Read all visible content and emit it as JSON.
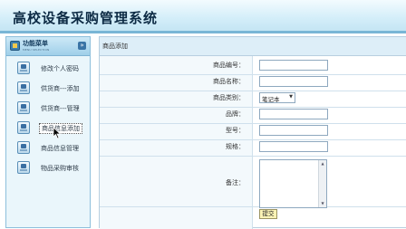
{
  "app": {
    "title": "高校设备采购管理系统"
  },
  "sidebar": {
    "title": "功能菜单",
    "subtitle": "MENU SELECTION",
    "items": [
      {
        "label": "修改个人密码",
        "icon": "user-key-icon"
      },
      {
        "label": "供货商---添加",
        "icon": "supplier-add-icon"
      },
      {
        "label": "供货商---管理",
        "icon": "supplier-manage-icon"
      },
      {
        "label": "商品信息添加",
        "icon": "product-add-icon",
        "selected": true
      },
      {
        "label": "商品信息管理",
        "icon": "product-manage-icon"
      },
      {
        "label": "物品采购审核",
        "icon": "purchase-review-icon"
      }
    ]
  },
  "form": {
    "panel_title": "商品添加",
    "fields": {
      "code": {
        "label": "商品编号：",
        "value": ""
      },
      "name": {
        "label": "商品名称：",
        "value": ""
      },
      "category": {
        "label": "商品类别：",
        "value": "笔记本"
      },
      "brand": {
        "label": "品牌：",
        "value": ""
      },
      "model": {
        "label": "型号：",
        "value": ""
      },
      "spec": {
        "label": "规格：",
        "value": ""
      },
      "remark": {
        "label": "备注：",
        "value": ""
      }
    },
    "submit_label": "提交"
  }
}
